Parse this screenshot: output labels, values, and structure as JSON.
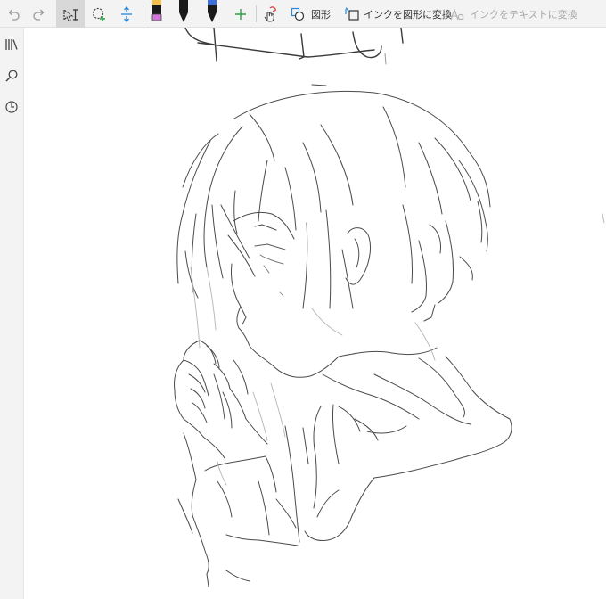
{
  "toolbar": {
    "shapes_label": "図形",
    "ink_to_shape_label": "インクを図形に変換",
    "ink_to_text_label": "インクをテキストに変換"
  },
  "colors": {
    "pen_yellow": "#f2c04a",
    "pen_pink": "#d07ad8",
    "pen_black": "#1a1a1a",
    "pen_blue": "#3c6fd8",
    "ruler_blue": "#2b88d8",
    "add_green": "#2e9e44",
    "active_bg": "#d8d8d8"
  },
  "icons": {
    "undo": "undo-icon",
    "redo": "redo-icon",
    "select": "select-text-icon",
    "lasso": "lasso-select-icon",
    "space": "insert-space-icon",
    "touch": "touch-draw-icon",
    "shapes": "shapes-icon",
    "ink_shape": "ink-to-shape-icon",
    "ink_text": "ink-to-text-icon",
    "notebooks": "notebooks-icon",
    "search": "search-icon",
    "recent": "recent-clock-icon"
  }
}
